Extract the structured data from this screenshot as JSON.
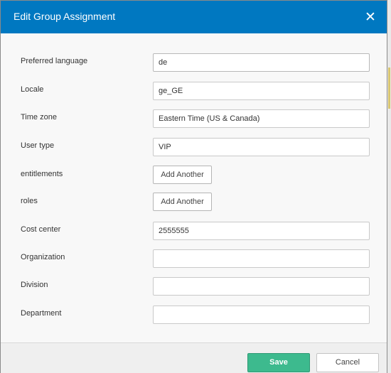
{
  "dialog": {
    "title": "Edit Group Assignment",
    "close_icon": "close-icon"
  },
  "colors": {
    "header": "#0078c1",
    "save_button": "#3dba8e"
  },
  "fields": [
    {
      "label": "Preferred language",
      "type": "text",
      "value": "de"
    },
    {
      "label": "Locale",
      "type": "text",
      "value": "ge_GE"
    },
    {
      "label": "Time zone",
      "type": "text",
      "value": "Eastern Time (US & Canada)"
    },
    {
      "label": "User type",
      "type": "text",
      "value": "VIP"
    },
    {
      "label": "entitlements",
      "type": "button",
      "button_label": "Add Another"
    },
    {
      "label": "roles",
      "type": "button",
      "button_label": "Add Another"
    },
    {
      "label": "Cost center",
      "type": "text",
      "value": "2555555"
    },
    {
      "label": "Organization",
      "type": "text",
      "value": ""
    },
    {
      "label": "Division",
      "type": "text",
      "value": ""
    },
    {
      "label": "Department",
      "type": "text",
      "value": ""
    }
  ],
  "footer": {
    "save_label": "Save",
    "cancel_label": "Cancel"
  }
}
